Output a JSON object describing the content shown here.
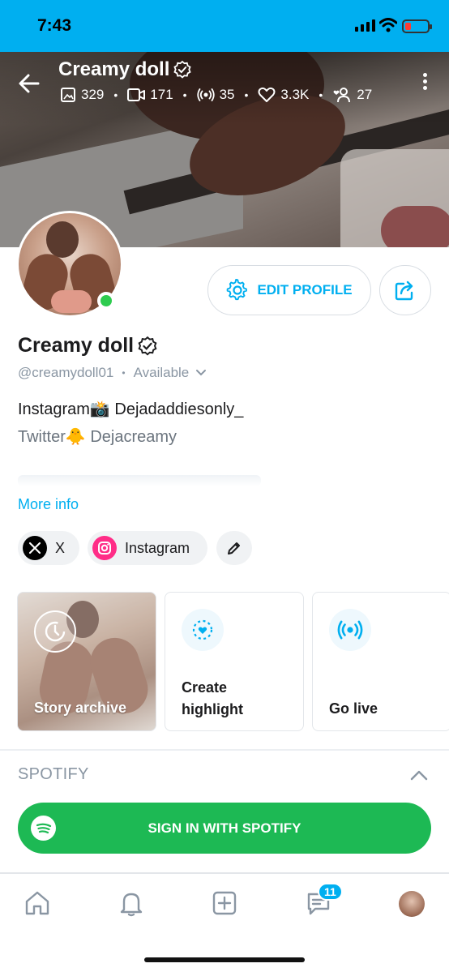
{
  "status_bar": {
    "time": "7:43"
  },
  "header": {
    "title": "Creamy doll",
    "stats": {
      "photos": "329",
      "videos": "171",
      "streams": "35",
      "likes": "3.3K",
      "fans": "27"
    }
  },
  "profile": {
    "name": "Creamy doll",
    "handle": "@creamydoll01",
    "availability": "Available",
    "bio_line1": "Instagram📸 Dejadaddiesonly_",
    "bio_line2": "Twitter🐥 Dejacreamy",
    "more_info": "More info",
    "edit_profile_label": "EDIT PROFILE"
  },
  "social_links": [
    {
      "label": "X",
      "icon": "x-logo-icon"
    },
    {
      "label": "Instagram",
      "icon": "instagram-logo-icon"
    }
  ],
  "cards": {
    "story_archive": "Story archive",
    "create_highlight_1": "Create",
    "create_highlight_2": "highlight",
    "go_live": "Go live"
  },
  "spotify": {
    "heading": "SPOTIFY",
    "sign_in": "SIGN IN WITH SPOTIFY"
  },
  "tabbar": {
    "items": [
      "home-icon",
      "bell-icon",
      "add-post-icon",
      "messages-icon",
      "profile-avatar"
    ],
    "messages_badge": "11"
  },
  "colors": {
    "accent": "#00aff0",
    "spotify": "#1db954",
    "online": "#2ecc4f"
  }
}
